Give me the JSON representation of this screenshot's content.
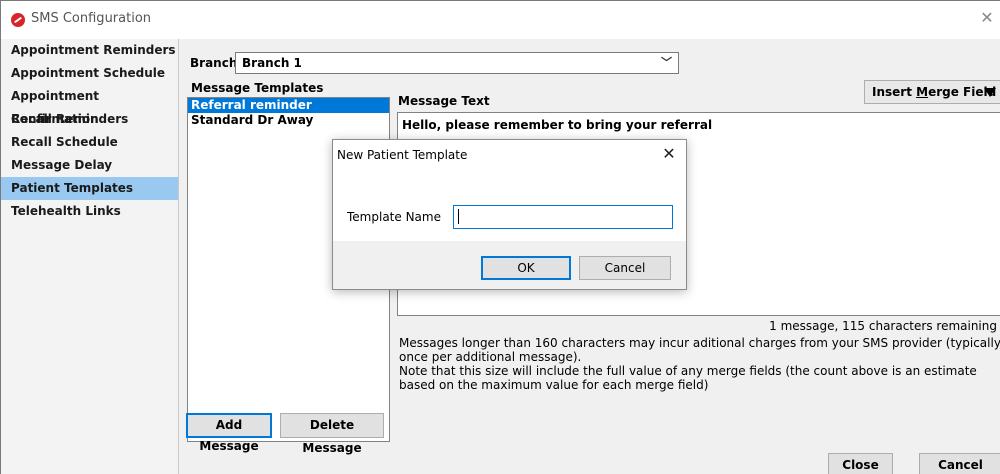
{
  "window": {
    "title": "SMS Configuration",
    "close_glyph": "✕"
  },
  "sidebar": {
    "items": [
      {
        "label": "Appointment Reminders",
        "selected": false
      },
      {
        "label": "Appointment Schedule",
        "selected": false
      },
      {
        "label": "Appointment Confirmation",
        "selected": false
      },
      {
        "label": "Recall Reminders",
        "selected": false
      },
      {
        "label": "Recall Schedule",
        "selected": false
      },
      {
        "label": "Message Delay",
        "selected": false
      },
      {
        "label": "Patient Templates",
        "selected": true
      },
      {
        "label": "Telehealth Links",
        "selected": false
      }
    ]
  },
  "branch": {
    "label": "Branch:",
    "value": "Branch 1"
  },
  "templates": {
    "label": "Message Templates",
    "items": [
      {
        "label": "Referral reminder",
        "selected": true
      },
      {
        "label": "Standard Dr Away",
        "selected": false
      }
    ]
  },
  "message": {
    "label": "Message Text",
    "text": "Hello, please remember to bring your referral",
    "insert_merge_field_prefix": "Insert ",
    "insert_merge_field_accel": "M",
    "insert_merge_field_suffix": "erge Field",
    "remaining": "1 message, 115 characters remaining",
    "note_line1": "Messages longer than 160 characters may incur aditional charges from your SMS provider (typically once per additional message).",
    "note_line2": "Note that this size will include the full value of any merge fields (the count above is an estimate based on the maximum value for each merge field)"
  },
  "buttons": {
    "add_message": "Add Message",
    "delete_message": "Delete Message",
    "close": "Close",
    "cancel": "Cancel"
  },
  "dialog": {
    "title": "New Patient Template",
    "close_glyph": "✕",
    "field_label": "Template Name",
    "field_value": "",
    "ok": "OK",
    "cancel": "Cancel"
  },
  "colors": {
    "accent": "#0078d7",
    "sidebar_selected": "#99c9f1",
    "brand": "#d7262b"
  }
}
